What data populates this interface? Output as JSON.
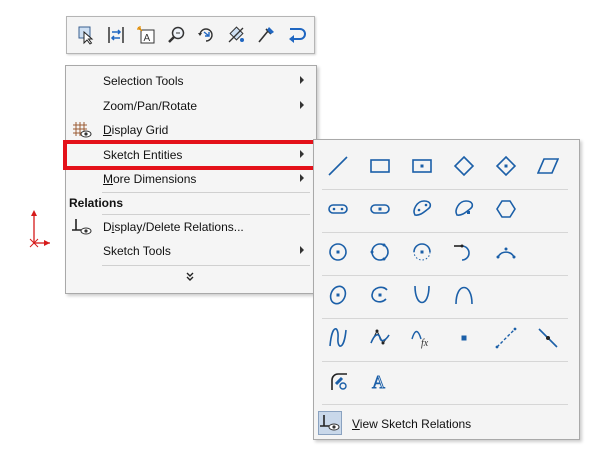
{
  "toolbar": {
    "buttons": [
      "select-icon",
      "dimension-icon",
      "smart-text-icon",
      "zoom-icon",
      "rotate-view-icon",
      "relations-icon",
      "sketch-icon",
      "undo-icon"
    ]
  },
  "menu": {
    "items": [
      {
        "label_pre": "",
        "label_ul": "",
        "label_rest": "Selection Tools",
        "submenu": true
      },
      {
        "label_pre": "",
        "label_ul": "",
        "label_rest": "Zoom/Pan/Rotate",
        "submenu": true
      },
      {
        "label_pre": "",
        "label_ul": "D",
        "label_rest": "isplay Grid",
        "submenu": false
      },
      {
        "label_pre": "",
        "label_ul": "",
        "label_rest": "Sketch Entities",
        "submenu": true
      },
      {
        "label_pre": "",
        "label_ul": "M",
        "label_rest": "ore Dimensions",
        "submenu": true
      }
    ],
    "section_label": "Relations",
    "relations_items": [
      {
        "label_pre": "D",
        "label_ul": "i",
        "label_rest": "splay/Delete Relations...",
        "submenu": false
      },
      {
        "label_pre": "",
        "label_ul": "",
        "label_rest": "Sketch Tools",
        "submenu": true
      }
    ],
    "more_icon": "double-chevron-down-icon"
  },
  "submenu": {
    "rows": [
      [
        "line-icon",
        "corner-rectangle-icon",
        "center-rectangle-icon",
        "3-point-corner-rectangle-icon",
        "3-point-center-rectangle-icon",
        "parallelogram-icon"
      ],
      [
        "straight-slot-icon",
        "centerpoint-straight-slot-icon",
        "3-point-arc-slot-icon",
        "centerpoint-arc-slot-icon",
        "polygon-icon"
      ],
      [
        "circle-icon",
        "perimeter-circle-icon",
        "centerpoint-arc-icon",
        "tangent-arc-icon",
        "3-point-arc-icon"
      ],
      [
        "ellipse-icon",
        "partial-ellipse-icon",
        "parabola-icon",
        "conic-icon"
      ],
      [
        "spline-icon",
        "style-spline-icon",
        "equation-driven-curve-icon",
        "point-icon",
        "centerline-icon",
        "midpoint-line-icon"
      ],
      [
        "fillet-chamfer-icon",
        "text-icon"
      ]
    ],
    "view_relations": {
      "label_ul": "V",
      "label_rest": "iew Sketch Relations"
    }
  }
}
